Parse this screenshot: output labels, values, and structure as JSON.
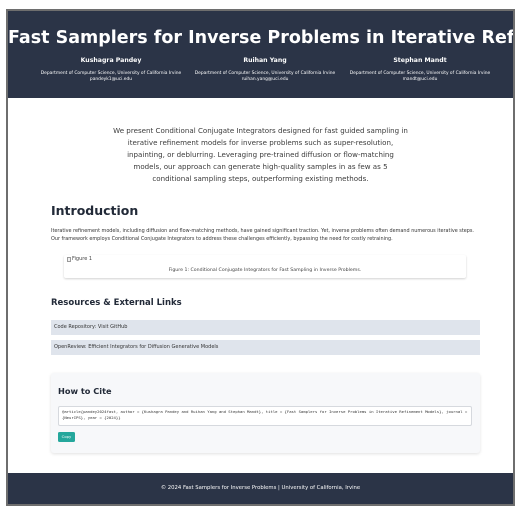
{
  "header": {
    "title": "Fast Samplers for Inverse Problems in Iterative Refinement Models",
    "authors": [
      {
        "name": "Kushagra Pandey",
        "dept": "Department of Computer Science, University of California Irvine",
        "email": "pandeyk1@uci.edu"
      },
      {
        "name": "Ruihan Yang",
        "dept": "Department of Computer Science, University of California Irvine",
        "email": "ruihan.yang@uci.edu"
      },
      {
        "name": "Stephan Mandt",
        "dept": "Department of Computer Science, University of California Irvine",
        "email": "mandt@uci.edu"
      }
    ]
  },
  "abstract": "We present Conditional Conjugate Integrators designed for fast guided sampling in iterative refinement models for inverse problems such as super-resolution, inpainting, or deblurring. Leveraging pre-trained diffusion or flow-matching models, our approach can generate high-quality samples in as few as 5 conditional sampling steps, outperforming existing methods.",
  "introduction": {
    "heading": "Introduction",
    "text": "Iterative refinement models, including diffusion and flow-matching methods, have gained significant traction. Yet, inverse problems often demand numerous iterative steps. Our framework employs Conditional Conjugate Integrators to address these challenges efficiently, bypassing the need for costly retraining.",
    "figure_alt": "Figure 1",
    "figure_caption": "Figure 1: Conditional Conjugate Integrators for Fast Sampling in Inverse Problems."
  },
  "resources": {
    "heading": "Resources & External Links",
    "links": [
      "Code Repository: Visit GitHub",
      "OpenReview: Efficient Integrators for Diffusion Generative Models"
    ]
  },
  "cite": {
    "heading": "How to Cite",
    "bibtex": "@article{pandey2024fast, author = {Kushagra Pandey and Ruihan Yang and Stephan Mandt}, title = {Fast Samplers for Inverse Problems in Iterative Refinement Models}, journal = {NeurIPS}, year = {2024}}",
    "copy_label": "Copy"
  },
  "footer": {
    "text": "© 2024 Fast Samplers for Inverse Problems | University of California, Irvine"
  },
  "colors": {
    "header_bg": "#2b3447",
    "link_bg": "#dfe4ec",
    "copy_button": "#25a79c"
  }
}
